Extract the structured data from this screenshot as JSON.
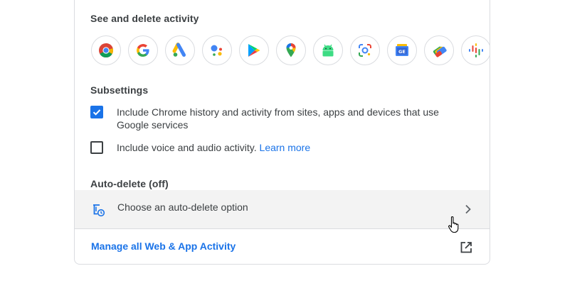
{
  "activity": {
    "title": "See and delete activity",
    "apps": [
      "chrome-icon",
      "google-icon",
      "google-ads-icon",
      "assistant-icon",
      "play-store-icon",
      "maps-icon",
      "android-icon",
      "lens-icon",
      "news-icon",
      "google-pay-icon",
      "podcasts-icon"
    ]
  },
  "subsettings": {
    "title": "Subsettings",
    "chrome_history": {
      "label": "Include Chrome history and activity from sites, apps and devices that use Google services",
      "checked": true
    },
    "voice_audio": {
      "label": "Include voice and audio activity.",
      "link": "Learn more",
      "checked": false
    }
  },
  "auto_delete": {
    "title": "Auto-delete (off)",
    "option_label": "Choose an auto-delete option"
  },
  "manage": {
    "label": "Manage all Web & App Activity"
  },
  "colors": {
    "accent": "#1a73e8",
    "border": "#dadce0",
    "row_bg": "#f3f3f3"
  }
}
